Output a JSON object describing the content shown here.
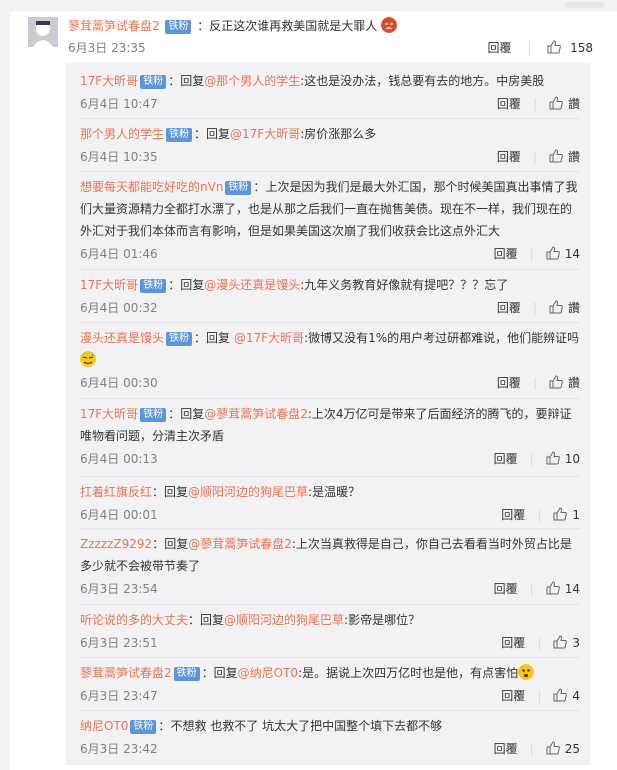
{
  "parent": {
    "username": "蓼茸蒿笋试春盘2",
    "badge": "铁粉",
    "text": "：反正这次谁再救美国就是大罪人",
    "time": "6月3日 23:35",
    "reply": "回覆",
    "likes": "158"
  },
  "replies": [
    {
      "username": "17F大昕哥",
      "badge": "铁粉",
      "prefix": "：回复",
      "mention": "@那个男人的学生",
      "text": ":这也是没办法，钱总要有去的地方。中房美股",
      "time": "6月4日 10:47",
      "reply": "回覆",
      "likes": "",
      "dislike": "讚"
    },
    {
      "username": "那个男人的学生",
      "badge": "铁粉",
      "prefix": "：回复",
      "mention": "@17F大昕哥",
      "text": ":房价涨那么多",
      "time": "6月4日 10:35",
      "reply": "回覆",
      "likes": "",
      "dislike": "讚"
    },
    {
      "username": "想要每天都能吃好吃的nVn",
      "badge": "铁粉",
      "prefix": "：",
      "mention": "",
      "text": "上次是因为我们是最大外汇国，那个时候美国真出事情了我们大量资源精力全都打水漂了，也是从那之后我们一直在抛售美债。现在不一样，我们现在的外汇对于我们本体而言有影响，但是如果美国这次崩了我们收获会比这点外汇大",
      "time": "6月4日 01:46",
      "reply": "回覆",
      "likes": "14",
      "dislike": ""
    },
    {
      "username": "17F大昕哥",
      "badge": "铁粉",
      "prefix": "：回复",
      "mention": "@漫头还真是馒头",
      "text": ":九年义务教育好像就有提吧？？？忘了",
      "time": "6月4日 00:32",
      "reply": "回覆",
      "likes": "",
      "dislike": "讚"
    },
    {
      "username": "漫头还真是馒头",
      "badge": "铁粉",
      "prefix": "：回复 ",
      "mention": "@17F大昕哥",
      "text": ":微博又没有1%的用户考过研都难说，他们能辨证吗",
      "time": "6月4日 00:30",
      "reply": "回覆",
      "likes": "",
      "dislike": "讚"
    },
    {
      "username": "17F大昕哥",
      "badge": "铁粉",
      "prefix": "：回复",
      "mention": "@蓼茸蒿笋试春盘2",
      "text": ":上次4万亿可是带来了后面经济的腾飞的，要辩证唯物看问题，分清主次矛盾",
      "time": "6月4日 00:13",
      "reply": "回覆",
      "likes": "10",
      "dislike": ""
    },
    {
      "username": "扛着红旗反红",
      "badge": "",
      "prefix": "：回复",
      "mention": "@顺阳河边的狗尾巴草",
      "text": ":是温暖？",
      "time": "6月4日 00:01",
      "reply": "回覆",
      "likes": "1",
      "dislike": ""
    },
    {
      "username": "ZzzzzZ9292",
      "badge": "",
      "prefix": "：回复",
      "mention": "@蓼茸蒿笋试春盘2",
      "text": ":上次当真救得是自己，你自己去看看当时外贸占比是多少就不会被带节奏了",
      "time": "6月3日 23:54",
      "reply": "回覆",
      "likes": "14",
      "dislike": ""
    },
    {
      "username": "听论说的多的大丈夫",
      "badge": "",
      "prefix": "：回复",
      "mention": "@顺阳河边的狗尾巴草",
      "text": ":影帝是哪位？",
      "time": "6月3日 23:51",
      "reply": "回覆",
      "likes": "3",
      "dislike": ""
    },
    {
      "username": "蓼茸蒿笋试春盘2",
      "badge": "铁粉",
      "prefix": "：回复",
      "mention": "@纳尼OT0",
      "text": ":是。据说上次四万亿时也是他，有点害怕",
      "time": "6月3日 23:47",
      "reply": "回覆",
      "likes": "4",
      "dislike": ""
    },
    {
      "username": "纳尼OT0",
      "badge": "铁粉",
      "prefix": "：",
      "mention": "",
      "text": "不想救 也救不了 坑太大了把中国整个填下去都不够",
      "time": "6月3日 23:42",
      "reply": "回覆",
      "likes": "25",
      "dislike": ""
    }
  ],
  "icons": {
    "like": "thumbs-up-icon",
    "dislike": "thumbs-down-icon",
    "emoji_angry": "angry-face-emoji",
    "emoji_sweat": "sweat-face-emoji",
    "emoji_nervous": "nervous-face-emoji"
  },
  "colors": {
    "username": "#eb7350",
    "badge": "#5b95de",
    "subBg": "#f2f2f5",
    "time": "#808080"
  }
}
